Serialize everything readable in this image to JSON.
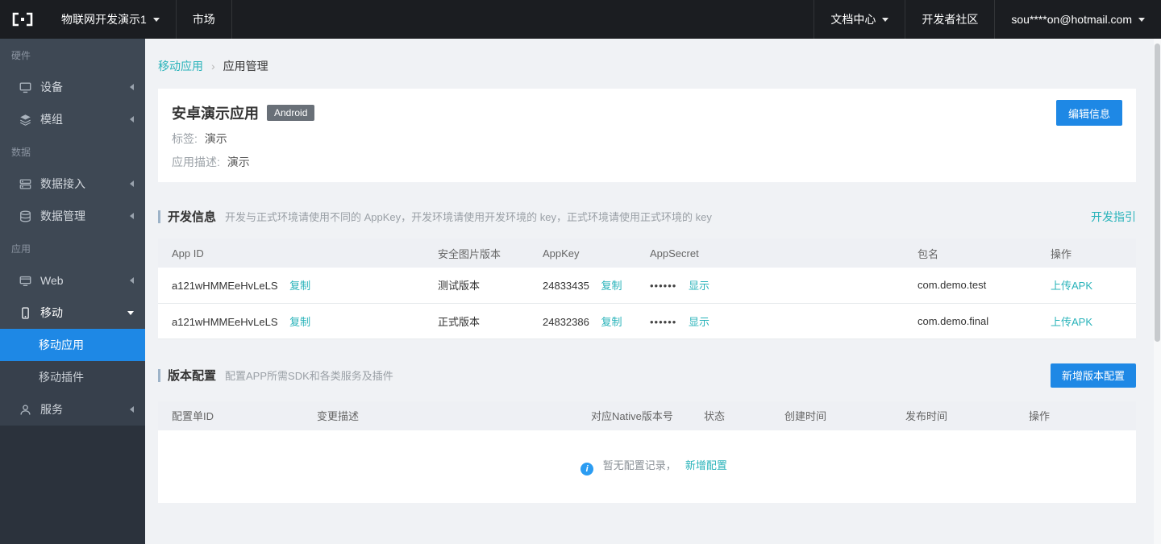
{
  "topbar": {
    "product": "物联网开发演示1",
    "market": "市场",
    "doc_center": "文档中心",
    "community": "开发者社区",
    "account": "sou****on@hotmail.com"
  },
  "sidebar": {
    "section_hardware": "硬件",
    "section_data": "数据",
    "section_app": "应用",
    "device": "设备",
    "module": "模组",
    "data_access": "数据接入",
    "data_manage": "数据管理",
    "web": "Web",
    "mobile": "移动",
    "mobile_app": "移动应用",
    "mobile_plugin": "移动插件",
    "service": "服务"
  },
  "breadcrumb": {
    "parent": "移动应用",
    "separator": "›",
    "current": "应用管理"
  },
  "app_card": {
    "title": "安卓演示应用",
    "platform_badge": "Android",
    "tag_label": "标签:",
    "tag_value": "演示",
    "desc_label": "应用描述:",
    "desc_value": "演示",
    "edit_button": "编辑信息"
  },
  "dev_info": {
    "title": "开发信息",
    "subtitle": "开发与正式环境请使用不同的 AppKey，开发环境请使用开发环境的 key，正式环境请使用正式环境的 key",
    "guide_link": "开发指引",
    "table": {
      "headers": [
        "App ID",
        "安全图片版本",
        "AppKey",
        "AppSecret",
        "包名",
        "操作"
      ],
      "copy_label": "复制",
      "show_label": "显示",
      "upload_label": "上传APK",
      "rows": [
        {
          "app_id": "a121wHMMEeHvLeLS",
          "security_version": "测试版本",
          "app_key": "24833435",
          "app_secret": "••••••",
          "package": "com.demo.test"
        },
        {
          "app_id": "a121wHMMEeHvLeLS",
          "security_version": "正式版本",
          "app_key": "24832386",
          "app_secret": "••••••",
          "package": "com.demo.final"
        }
      ]
    }
  },
  "version_config": {
    "title": "版本配置",
    "subtitle": "配置APP所需SDK和各类服务及插件",
    "add_button": "新增版本配置",
    "table": {
      "headers": [
        "配置单ID",
        "变更描述",
        "对应Native版本号",
        "状态",
        "创建时间",
        "发布时间",
        "操作"
      ]
    },
    "empty": {
      "icon_glyph": "i",
      "text": "暂无配置记录，",
      "link": "新增配置"
    }
  },
  "colors": {
    "accent_blue": "#1e88e5",
    "link_cyan": "#29b3ba",
    "sidebar_active": "#1e88e5"
  }
}
